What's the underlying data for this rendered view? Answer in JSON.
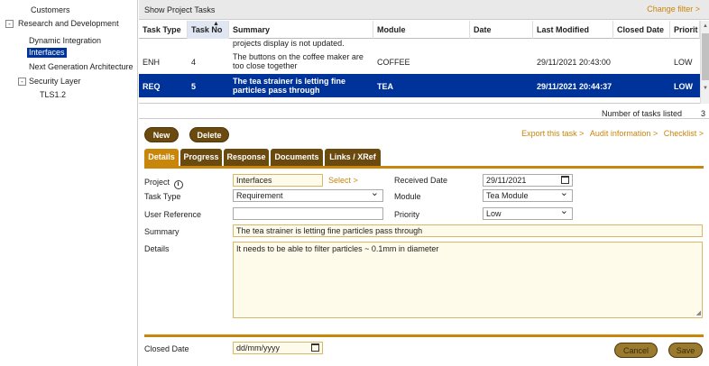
{
  "tree": {
    "customers": "Customers",
    "research": "Research and Development",
    "dynamic": "Dynamic Integration",
    "interfaces": "Interfaces",
    "nextgen": "Next Generation Architecture",
    "security": "Security Layer",
    "tls": "TLS1.2",
    "toggle_minus": "-"
  },
  "list": {
    "title": "Show Project Tasks",
    "change_filter": "Change filter >",
    "columns": {
      "type": "Task Type",
      "no": "Task No",
      "summary": "Summary",
      "module": "Module",
      "date": "Date",
      "modified": "Last Modified",
      "closed": "Closed Date",
      "priority": "Priorit"
    },
    "rows": [
      {
        "type": "",
        "no": "",
        "summary": "projects display is not updated.",
        "module": "",
        "date": "",
        "modified": "",
        "closed": "",
        "priority": ""
      },
      {
        "type": "ENH",
        "no": "4",
        "summary": "The buttons on the coffee maker are too close together",
        "module": "COFFEE",
        "date": "",
        "modified": "29/11/2021 20:43:00",
        "closed": "",
        "priority": "LOW"
      },
      {
        "type": "REQ",
        "no": "5",
        "summary": "The tea strainer is letting fine particles pass through",
        "module": "TEA",
        "date": "",
        "modified": "29/11/2021 20:44:37",
        "closed": "",
        "priority": "LOW"
      }
    ],
    "count_label": "Number of tasks listed",
    "count_value": "3"
  },
  "actions": {
    "new": "New",
    "delete": "Delete",
    "export": "Export this task >",
    "audit": "Audit information >",
    "checklist": "Checklist >"
  },
  "tabs": [
    "Details",
    "Progress",
    "Response",
    "Documents",
    "Links / XRef"
  ],
  "form": {
    "project_label": "Project",
    "project_value": "Interfaces",
    "select_link": "Select >",
    "received_label": "Received Date",
    "received_value": "29/11/2021",
    "tasktype_label": "Task Type",
    "tasktype_value": "Requirement",
    "module_label": "Module",
    "module_value": "Tea Module",
    "userref_label": "User Reference",
    "userref_value": "",
    "priority_label": "Priority",
    "priority_value": "Low",
    "summary_label": "Summary",
    "summary_value": "The tea strainer is letting fine particles pass through",
    "details_label": "Details",
    "details_value": "It needs to be able to filter particles ~ 0.1mm in diameter",
    "closed_label": "Closed Date",
    "closed_placeholder": "dd/mm/yyyy"
  },
  "footer": {
    "cancel": "Cancel",
    "save": "Save"
  },
  "colors": {
    "accent": "#c8860b",
    "button": "#6b4a0f",
    "selection": "#003399"
  }
}
